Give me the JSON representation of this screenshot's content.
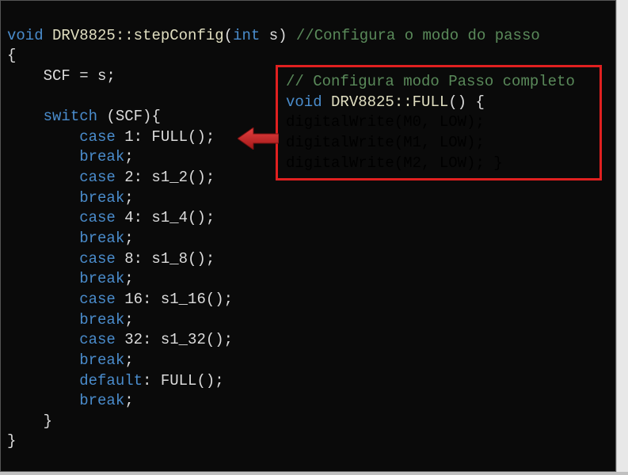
{
  "main": {
    "line1_kw1": "void",
    "line1_cls": " DRV8825::",
    "line1_fn": "stepConfig",
    "line1_paren_open": "(",
    "line1_kw2": "int",
    "line1_arg": " s) ",
    "line1_cm": "//Configura o modo do passo",
    "line2": "{",
    "line3": "    SCF = s;",
    "line4": "",
    "line5_a": "    ",
    "line5_kw": "switch",
    "line5_b": " (SCF){",
    "line6_a": "        ",
    "line6_kw": "case",
    "line6_b": " 1: FULL();",
    "line7_a": "        ",
    "line7_kw": "break",
    "line7_b": ";",
    "line8_a": "        ",
    "line8_kw": "case",
    "line8_b": " 2: s1_2();",
    "line9_a": "        ",
    "line9_kw": "break",
    "line9_b": ";",
    "line10_a": "        ",
    "line10_kw": "case",
    "line10_b": " 4: s1_4();",
    "line11_a": "        ",
    "line11_kw": "break",
    "line11_b": ";",
    "line12_a": "        ",
    "line12_kw": "case",
    "line12_b": " 8: s1_8();",
    "line13_a": "        ",
    "line13_kw": "break",
    "line13_b": ";",
    "line14_a": "        ",
    "line14_kw": "case",
    "line14_b": " 16: s1_16();",
    "line15_a": "        ",
    "line15_kw": "break",
    "line15_b": ";",
    "line16_a": "        ",
    "line16_kw": "case",
    "line16_b": " 32: s1_32();",
    "line17_a": "        ",
    "line17_kw": "break",
    "line17_b": ";",
    "line18_a": "        ",
    "line18_kw": "default",
    "line18_b": ": FULL();",
    "line19_a": "        ",
    "line19_kw": "break",
    "line19_b": ";",
    "line20": "    }",
    "line21": "}"
  },
  "callout": {
    "c1": "// Configura modo Passo completo",
    "c2_kw": "void",
    "c2_cls": " DRV8825::",
    "c2_fn": "FULL",
    "c2_rest": "() {",
    "c3": "    digitalWrite(M0, LOW);",
    "c4": "    digitalWrite(M1, LOW);",
    "c5": "    digitalWrite(M2, LOW);",
    "c6": "}"
  },
  "colors": {
    "bg": "#0a0a0a",
    "fg": "#dcdcdc",
    "keyword": "#4a8ccc",
    "func": "#e0dec0",
    "comment": "#5a8a5a",
    "callout_border": "#e02020",
    "arrow": "#c02020"
  }
}
